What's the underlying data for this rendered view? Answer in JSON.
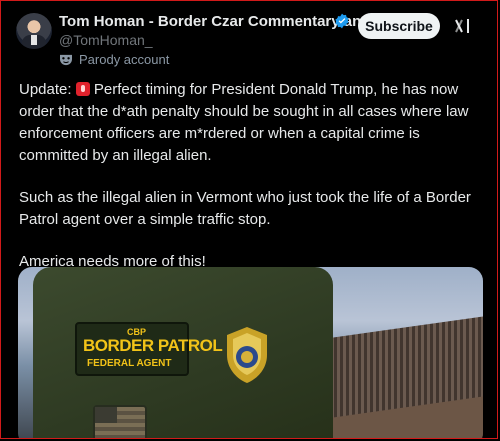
{
  "post": {
    "author_name": "Tom Homan - Border Czar Commentary and ...",
    "handle": "@TomHoman_",
    "parody_label": "Parody account",
    "subscribe_label": "Subscribe",
    "paragraphs": [
      "Perfect timing for President Donald Trump, he has now order that the d*ath penalty should be sought in all cases where law enforcement officers are m*rdered or when a capital crime is committed by an illegal alien.",
      "Such as the illegal alien in Vermont who just took the life of a Border Patrol agent over a simple traffic stop.",
      "America needs more of this!"
    ],
    "update_prefix": "Update:"
  },
  "media": {
    "patch_top": "CBP",
    "patch_main": "BORDER PATROL",
    "patch_sub": "FEDERAL AGENT"
  },
  "icons": {
    "verified": "verified-badge-icon",
    "parody": "parody-mask-icon",
    "grok": "grok-icon",
    "siren": "siren-emoji-icon"
  },
  "colors": {
    "background": "#000000",
    "text": "#e7e9ea",
    "secondary": "#71767b",
    "verified": "#1d9bf0",
    "subscribe_bg": "#eff3f4",
    "frame_border": "#d11a1a",
    "patch_text": "#f2c318"
  }
}
